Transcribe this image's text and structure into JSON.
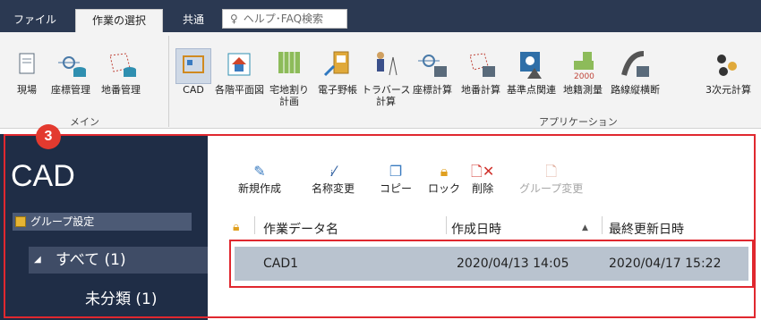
{
  "tabs": [
    {
      "label": "ファイル"
    },
    {
      "label": "作業の選択"
    },
    {
      "label": "共通"
    }
  ],
  "help": {
    "placeholder": "ヘルプ･FAQ検索"
  },
  "ribbon": {
    "main_group": {
      "label": "メイン",
      "items": [
        {
          "label": "現場"
        },
        {
          "label": "座標管理"
        },
        {
          "label": "地番管理"
        }
      ]
    },
    "apps_group": {
      "label": "アプリケーション",
      "items": [
        {
          "label": "CAD"
        },
        {
          "label": "各階平面図"
        },
        {
          "label": "宅地割り",
          "label2": "計画"
        },
        {
          "label": "電子野帳"
        },
        {
          "label": "トラバース",
          "label2": "計算"
        },
        {
          "label": "座標計算"
        },
        {
          "label": "地番計算"
        },
        {
          "label": "基準点関連"
        },
        {
          "label": "地籍測量"
        },
        {
          "label": "路線縦横断"
        },
        {
          "label": "3次元計算"
        }
      ]
    }
  },
  "leftpane": {
    "title": "CAD",
    "group_setting": "グループ設定",
    "tree": [
      {
        "label": "すべて (1)"
      },
      {
        "label": "未分類 (1)"
      }
    ]
  },
  "toolbar": [
    {
      "label": "新規作成",
      "icon": "new-icon"
    },
    {
      "label": "名称変更",
      "icon": "rename-icon"
    },
    {
      "label": "コピー",
      "icon": "copy-icon"
    },
    {
      "label": "ロック",
      "icon": "lock-icon"
    },
    {
      "label": "削除",
      "icon": "delete-icon"
    },
    {
      "label": "グループ変更",
      "icon": "group-change-icon",
      "disabled": true
    }
  ],
  "list": {
    "headers": [
      "作業データ名",
      "作成日時",
      "最終更新日時"
    ],
    "rows": [
      {
        "name": "CAD1",
        "created": "2020/04/13 14:05",
        "updated": "2020/04/17 15:22"
      }
    ]
  },
  "badge": "3",
  "colors": {
    "accent_red": "#e0282f",
    "header_navy": "#2b3952",
    "pane_navy": "#1f2d46"
  }
}
